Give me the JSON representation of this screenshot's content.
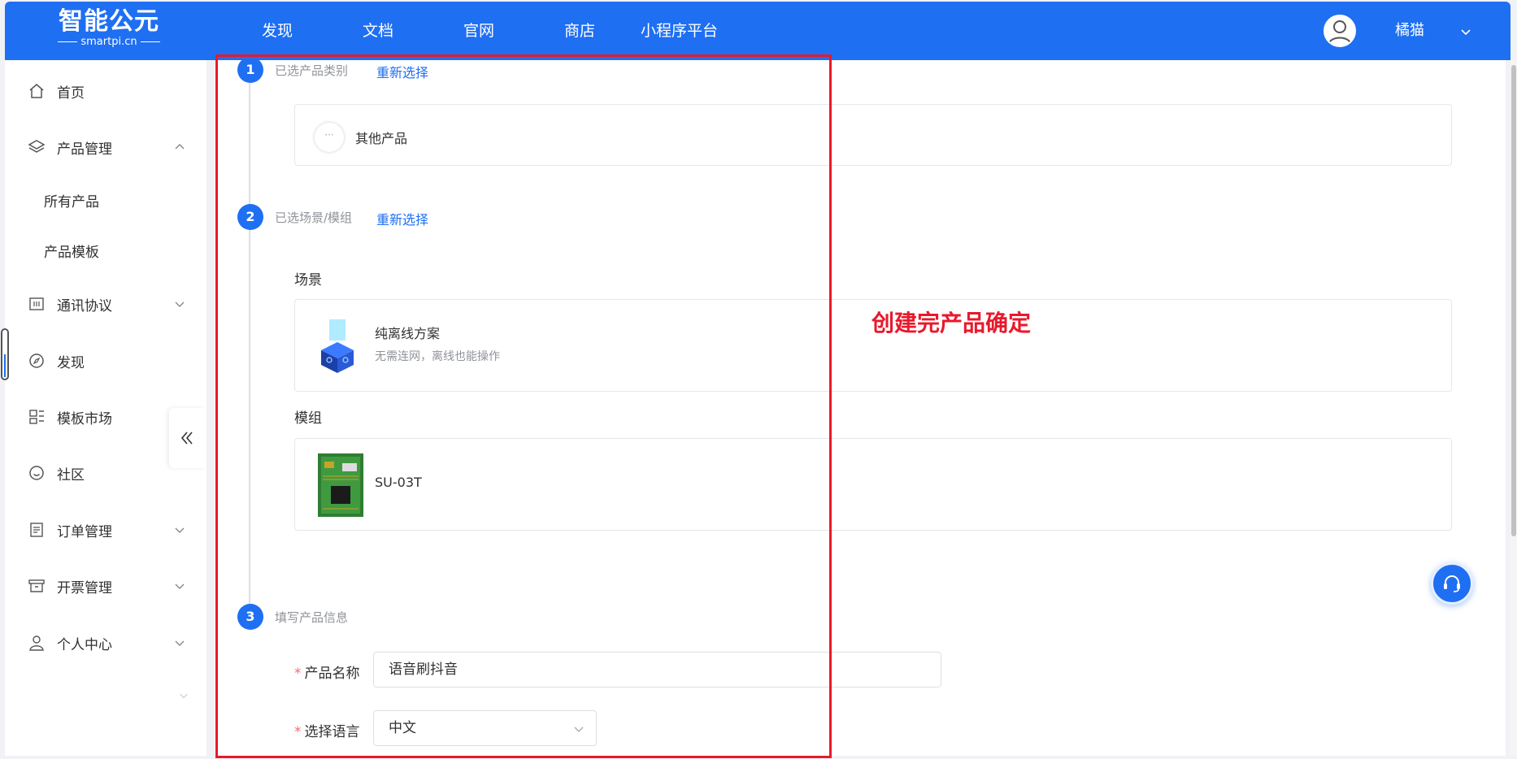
{
  "header": {
    "logo_title": "智能公元",
    "logo_subtitle": "smartpi.cn",
    "nav": [
      "发现",
      "文档",
      "官网",
      "商店",
      "小程序平台"
    ],
    "user_name": "橘猫"
  },
  "sidebar": {
    "items": [
      {
        "label": "首页",
        "icon": "home-icon"
      },
      {
        "label": "产品管理",
        "icon": "layers-icon",
        "expanded": true
      },
      {
        "label": "通讯协议",
        "icon": "protocol-icon"
      },
      {
        "label": "发现",
        "icon": "compass-icon"
      },
      {
        "label": "模板市场",
        "icon": "template-icon"
      },
      {
        "label": "社区",
        "icon": "smile-icon"
      },
      {
        "label": "订单管理",
        "icon": "document-icon"
      },
      {
        "label": "开票管理",
        "icon": "archive-icon"
      },
      {
        "label": "个人中心",
        "icon": "user-icon"
      }
    ],
    "sub_items": [
      "所有产品",
      "产品模板"
    ]
  },
  "steps": {
    "step1": {
      "number": "1",
      "title": "已选产品类别",
      "reselect": "重新选择"
    },
    "step2": {
      "number": "2",
      "title": "已选场景/模组",
      "reselect": "重新选择"
    },
    "step3": {
      "number": "3",
      "title": "填写产品信息"
    }
  },
  "product_category": {
    "name": "其他产品"
  },
  "scene": {
    "section_label": "场景",
    "name": "纯离线方案",
    "description": "无需连网，离线也能操作"
  },
  "module": {
    "section_label": "模组",
    "name": "SU-03T"
  },
  "form": {
    "product_name_label": "产品名称",
    "product_name_value": "语音刷抖音",
    "language_label": "选择语言",
    "language_value": "中文"
  },
  "annotation": {
    "text": "创建完产品确定",
    "color": "#e8192c"
  },
  "colors": {
    "primary": "#1f6ff2",
    "required": "#f56c6c"
  }
}
